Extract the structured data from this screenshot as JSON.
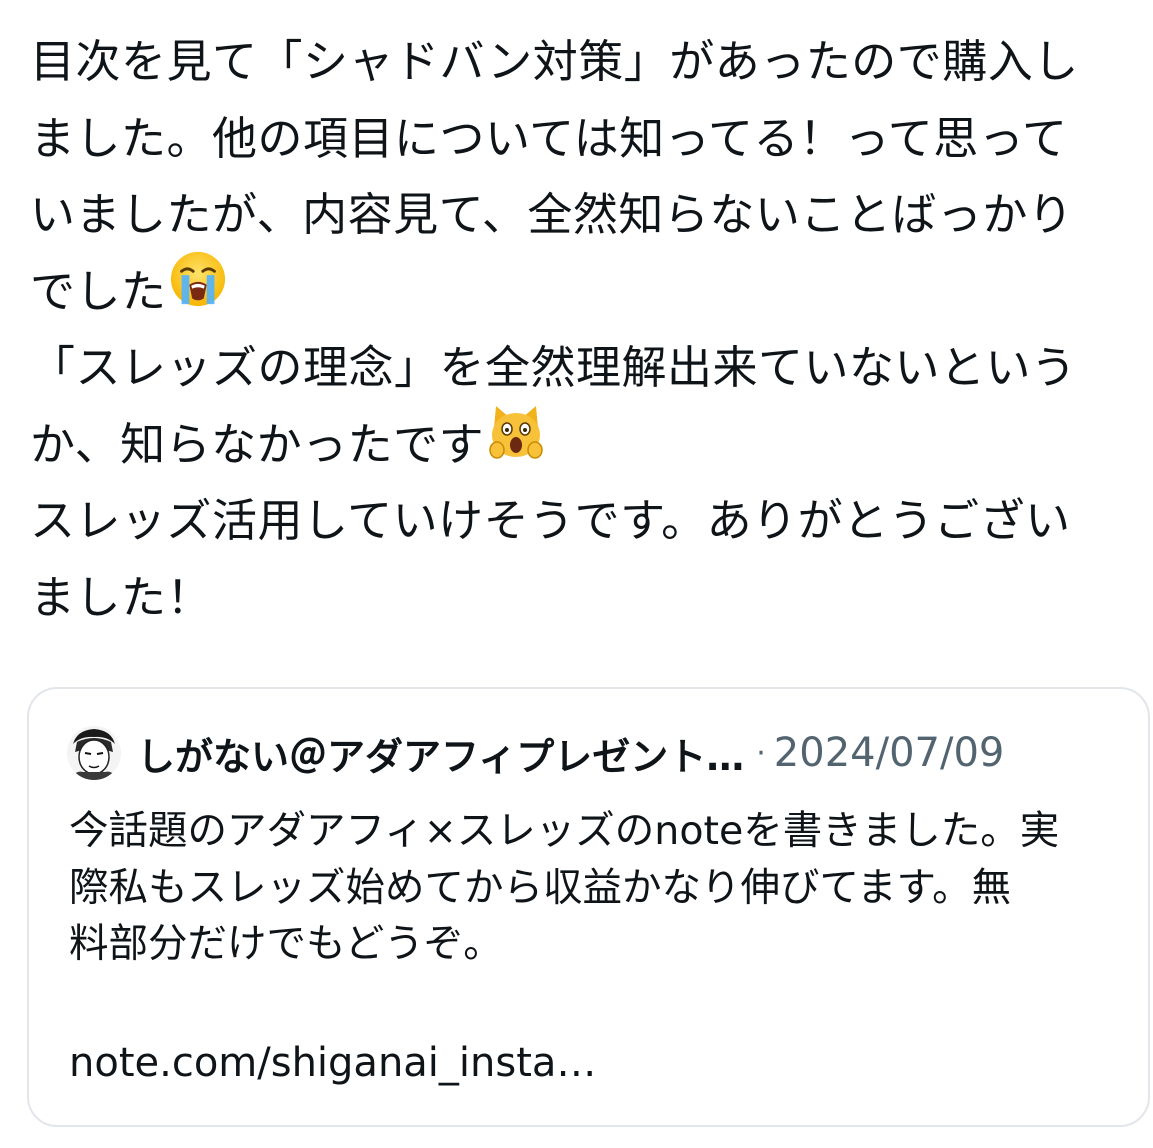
{
  "post": {
    "lines": [
      "目次を見て「シャドバン対策」があったので購入し",
      "ました。他の項目については知ってる！って思って",
      "いましたが、内容見て、全然知らないことばっかり",
      "でした",
      "「スレッズの理念」を全然理解出来ていないという",
      "か、知らなかったです",
      "スレッズ活用していけそうです。ありがとうござい",
      "ました！"
    ],
    "emojis": {
      "crying": "loudly-crying-face",
      "cat": "weary-cat-face"
    }
  },
  "quote": {
    "author": "しがない＠アダアフィプレゼント…",
    "separator": "·",
    "date": "2024/07/09",
    "lines": [
      "今話題のアダアフィ×スレッズのnoteを書きました。実",
      "際私もスレッズ始めてから収益かなり伸びてます。無",
      "料部分だけでもどうぞ。"
    ],
    "link": "note.com/shiganai_insta…"
  },
  "colors": {
    "text": "#0f1419",
    "secondary": "#536471",
    "border": "#e2e6ea"
  }
}
